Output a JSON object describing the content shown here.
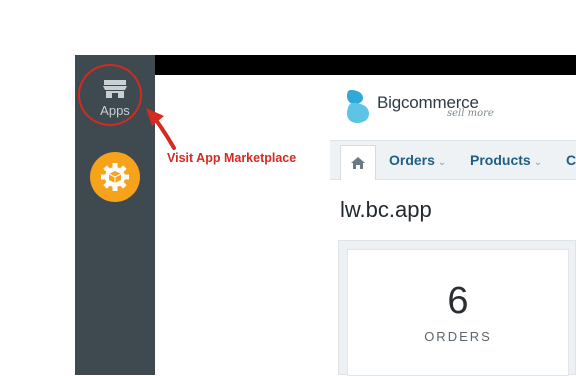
{
  "sidebar": {
    "apps_label": "Apps",
    "apps_icon": "store-icon",
    "marketplace_icon": "gear-box-icon"
  },
  "annotation": {
    "text": "Visit App Marketplace",
    "color": "#d42a1f"
  },
  "logo": {
    "name": "Bigcommerce",
    "tagline": "sell more"
  },
  "nav": {
    "home_icon": "home-icon",
    "items": [
      {
        "label": "Orders"
      },
      {
        "label": "Products"
      },
      {
        "label": "C"
      }
    ]
  },
  "store": {
    "title": "lw.bc.app"
  },
  "stats": {
    "orders_value": "6",
    "orders_label": "ORDERS"
  },
  "colors": {
    "sidebar": "#3e4a50",
    "accent_orange": "#f7a21b",
    "nav_link": "#1e5f86"
  }
}
